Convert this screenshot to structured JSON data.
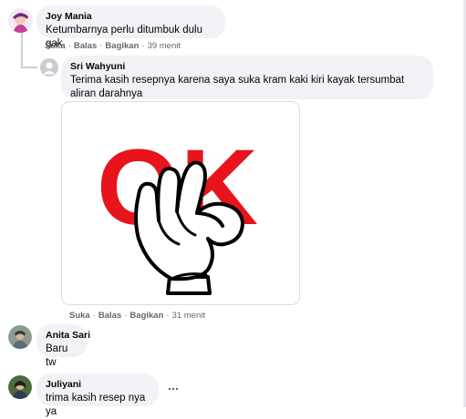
{
  "actions": {
    "like": "Suka",
    "reply": "Balas",
    "share": "Bagikan",
    "separator": "·"
  },
  "comments": [
    {
      "author": "Joy Mania",
      "text": "Ketumbarnya perlu ditumbuk dulu gak",
      "time": "39 menit"
    },
    {
      "author": "Sri Wahyuni",
      "text": "Terima kasih resepnya karena saya suka kram kaki kiri kayak tersumbat aliran darahnya",
      "time": "31 menit",
      "sticker": {
        "text": "OK",
        "icon": "ok-hand-sticker"
      }
    },
    {
      "author": "Anita Sari",
      "text": "Baru tw"
    },
    {
      "author": "Juliyani",
      "text": "trima kasih resep nya ya",
      "more_icon": "more-options-icon"
    }
  ],
  "colors": {
    "bubble": "#f0f2f5",
    "meta": "#65676b",
    "sticker_red": "#e8141c"
  }
}
